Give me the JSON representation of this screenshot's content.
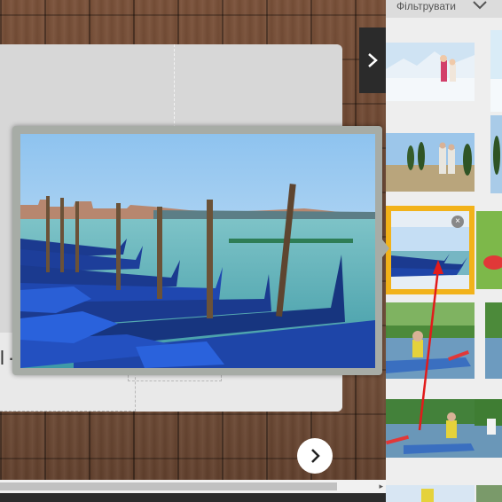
{
  "filter": {
    "label": "Фільтрувати"
  },
  "icons": {
    "panel_toggle": "chevron-right-icon",
    "next": "chevron-right-icon",
    "add_image": "add-image-icon",
    "filter_dropdown": "chevron-down-icon",
    "remove": "close-icon",
    "scroll_right": "triangle-right-icon"
  },
  "canvas": {
    "text_glyphs": "l·¬"
  },
  "gallery": {
    "selected_index": 2,
    "accent_color": "#f2b21a",
    "scroll_arrow": "▸"
  },
  "remove_label": "×",
  "colors": {
    "selection": "#f2b21a",
    "panel_toggle_bg": "#2b2b2b",
    "arrow": "#e21b1b"
  }
}
